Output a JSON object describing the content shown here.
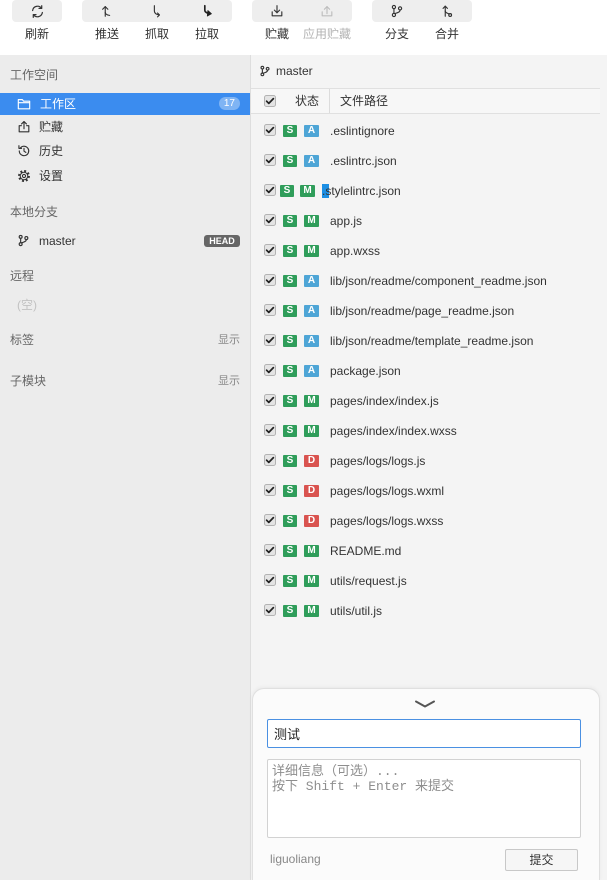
{
  "toolbar": {
    "refresh": {
      "label": "刷新",
      "icon": "refresh-icon"
    },
    "push": {
      "label": "推送",
      "icon": "push-icon"
    },
    "fetch": {
      "label": "抓取",
      "icon": "fetch-icon"
    },
    "pull": {
      "label": "拉取",
      "icon": "pull-icon"
    },
    "stash": {
      "label": "贮藏",
      "icon": "stash-icon"
    },
    "apply_stash": {
      "label": "应用贮藏",
      "icon": "apply-stash-icon",
      "disabled": true
    },
    "branch": {
      "label": "分支",
      "icon": "branch-icon"
    },
    "merge": {
      "label": "合并",
      "icon": "merge-icon"
    }
  },
  "sidebar": {
    "workspace": {
      "header": "工作空间",
      "items": [
        {
          "label": "工作区",
          "icon": "folder-icon",
          "badge": "17",
          "selected": true
        },
        {
          "label": "贮藏",
          "icon": "stash-box-icon"
        },
        {
          "label": "历史",
          "icon": "history-icon"
        },
        {
          "label": "设置",
          "icon": "gear-icon"
        }
      ]
    },
    "local_branches": {
      "header": "本地分支",
      "items": [
        {
          "label": "master",
          "icon": "branch-icon",
          "badge": "HEAD"
        }
      ]
    },
    "remote": {
      "header": "远程",
      "empty_text": "(空)"
    },
    "tags": {
      "header": "标签",
      "toggle": "显示"
    },
    "submodules": {
      "header": "子模块",
      "toggle": "显示"
    }
  },
  "main": {
    "branch": {
      "icon": "branch-icon",
      "name": "master"
    },
    "table": {
      "all_checked": true,
      "columns": {
        "status": "状态",
        "path": "文件路径"
      },
      "rows": [
        {
          "checked": true,
          "stage": "S",
          "status": "A",
          "path": ".eslintignore"
        },
        {
          "checked": true,
          "stage": "S",
          "status": "A",
          "path": ".eslintrc.json"
        },
        {
          "checked": true,
          "stage": "S",
          "status": "M",
          "path": ".stylelintrc.json",
          "highlight": true
        },
        {
          "checked": true,
          "stage": "S",
          "status": "M",
          "path": "app.js"
        },
        {
          "checked": true,
          "stage": "S",
          "status": "M",
          "path": "app.wxss"
        },
        {
          "checked": true,
          "stage": "S",
          "status": "A",
          "path": "lib/json/readme/component_readme.json"
        },
        {
          "checked": true,
          "stage": "S",
          "status": "A",
          "path": "lib/json/readme/page_readme.json"
        },
        {
          "checked": true,
          "stage": "S",
          "status": "A",
          "path": "lib/json/readme/template_readme.json"
        },
        {
          "checked": true,
          "stage": "S",
          "status": "A",
          "path": "package.json"
        },
        {
          "checked": true,
          "stage": "S",
          "status": "M",
          "path": "pages/index/index.js"
        },
        {
          "checked": true,
          "stage": "S",
          "status": "M",
          "path": "pages/index/index.wxss"
        },
        {
          "checked": true,
          "stage": "S",
          "status": "D",
          "path": "pages/logs/logs.js"
        },
        {
          "checked": true,
          "stage": "S",
          "status": "D",
          "path": "pages/logs/logs.wxml"
        },
        {
          "checked": true,
          "stage": "S",
          "status": "D",
          "path": "pages/logs/logs.wxss"
        },
        {
          "checked": true,
          "stage": "S",
          "status": "M",
          "path": "README.md"
        },
        {
          "checked": true,
          "stage": "S",
          "status": "M",
          "path": "utils/request.js"
        },
        {
          "checked": true,
          "stage": "S",
          "status": "M",
          "path": "utils/util.js"
        }
      ]
    }
  },
  "commit": {
    "collapse_icon": "chevron-down-icon",
    "summary": "测试",
    "description_placeholder": "详细信息（可选）...\n按下 Shift + Enter 来提交",
    "author": "liguoliang",
    "submit_label": "提交"
  },
  "colors": {
    "accent": "#3b8cef",
    "head_badge": "#666666",
    "focus_border": "#4a90e2",
    "badges": {
      "S": "#2f9d5a",
      "M": "#2f9d5a",
      "A": "#4ea5d6",
      "D": "#d9534f"
    }
  }
}
